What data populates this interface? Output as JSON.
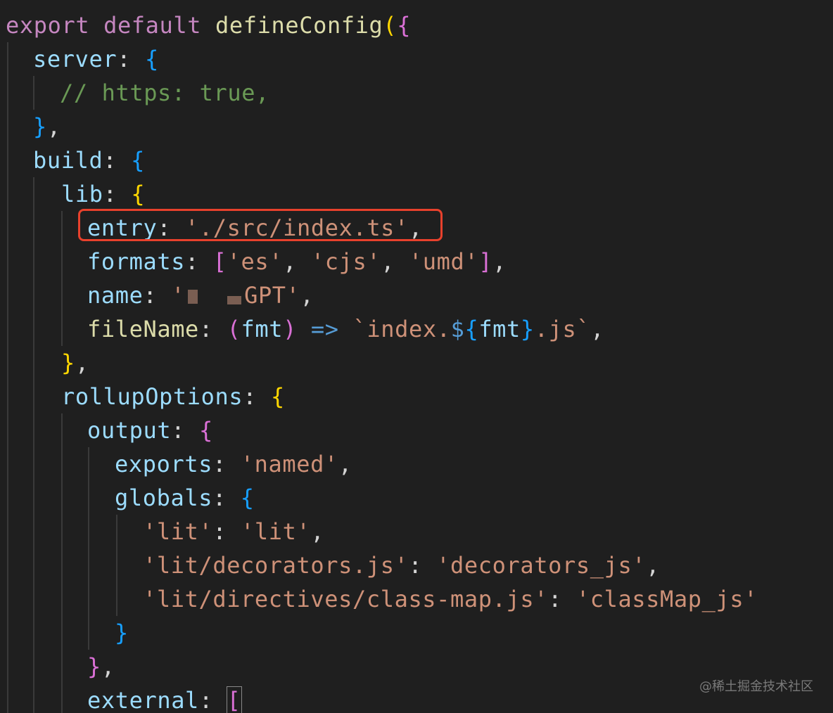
{
  "code": {
    "l1": {
      "export": "export",
      "default": "default",
      "fn": "defineConfig",
      "paren": "(",
      "brace": "{"
    },
    "l2": {
      "key": "server",
      "colon": ": ",
      "brace": "{"
    },
    "l3": {
      "comment": "// https: true,"
    },
    "l4": {
      "brace": "}",
      "comma": ","
    },
    "l5": {
      "key": "build",
      "colon": ": ",
      "brace": "{"
    },
    "l6": {
      "key": "lib",
      "colon": ": ",
      "brace": "{"
    },
    "l7": {
      "key": "entry",
      "colon": ": ",
      "value": "'./src/index.ts'",
      "comma": ","
    },
    "l8": {
      "key": "formats",
      "colon": ": ",
      "open": "[",
      "v1": "'es'",
      "sep1": ", ",
      "v2": "'cjs'",
      "sep2": ", ",
      "v3": "'umd'",
      "close": "]",
      "comma": ","
    },
    "l9": {
      "key": "name",
      "colon": ": ",
      "q": "'",
      "visible": "GPT'",
      "comma": ","
    },
    "l10": {
      "key": "fileName",
      "colon": ": ",
      "popen": "(",
      "param": "fmt",
      "pclose": ")",
      "arrow": " => ",
      "tpl1": "`index.",
      "dollar": "$",
      "iopen": "{",
      "ivar": "fmt",
      "iclose": "}",
      "tpl2": ".js`",
      "comma": ","
    },
    "l11": {
      "brace": "}",
      "comma": ","
    },
    "l12": {
      "key": "rollupOptions",
      "colon": ": ",
      "brace": "{"
    },
    "l13": {
      "key": "output",
      "colon": ": ",
      "brace": "{"
    },
    "l14": {
      "key": "exports",
      "colon": ": ",
      "value": "'named'",
      "comma": ","
    },
    "l15": {
      "key": "globals",
      "colon": ": ",
      "brace": "{"
    },
    "l16": {
      "k": "'lit'",
      "colon": ": ",
      "v": "'lit'",
      "comma": ","
    },
    "l17": {
      "k": "'lit/decorators.js'",
      "colon": ": ",
      "v": "'decorators_js'",
      "comma": ","
    },
    "l18": {
      "k": "'lit/directives/class-map.js'",
      "colon": ": ",
      "v": "'classMap_js'"
    },
    "l19": {
      "brace": "}"
    },
    "l20": {
      "brace": "}",
      "comma": ","
    },
    "l21": {
      "key": "external",
      "colon": ": ",
      "open": "["
    }
  },
  "watermark": "@稀土掘金技术社区",
  "colors": {
    "background": "#1f1f1f",
    "keyword": "#c586c0",
    "function": "#dcdcaa",
    "property": "#9cdcfe",
    "string": "#ce9178",
    "comment": "#6a9955",
    "highlight_box": "#e8412c"
  }
}
